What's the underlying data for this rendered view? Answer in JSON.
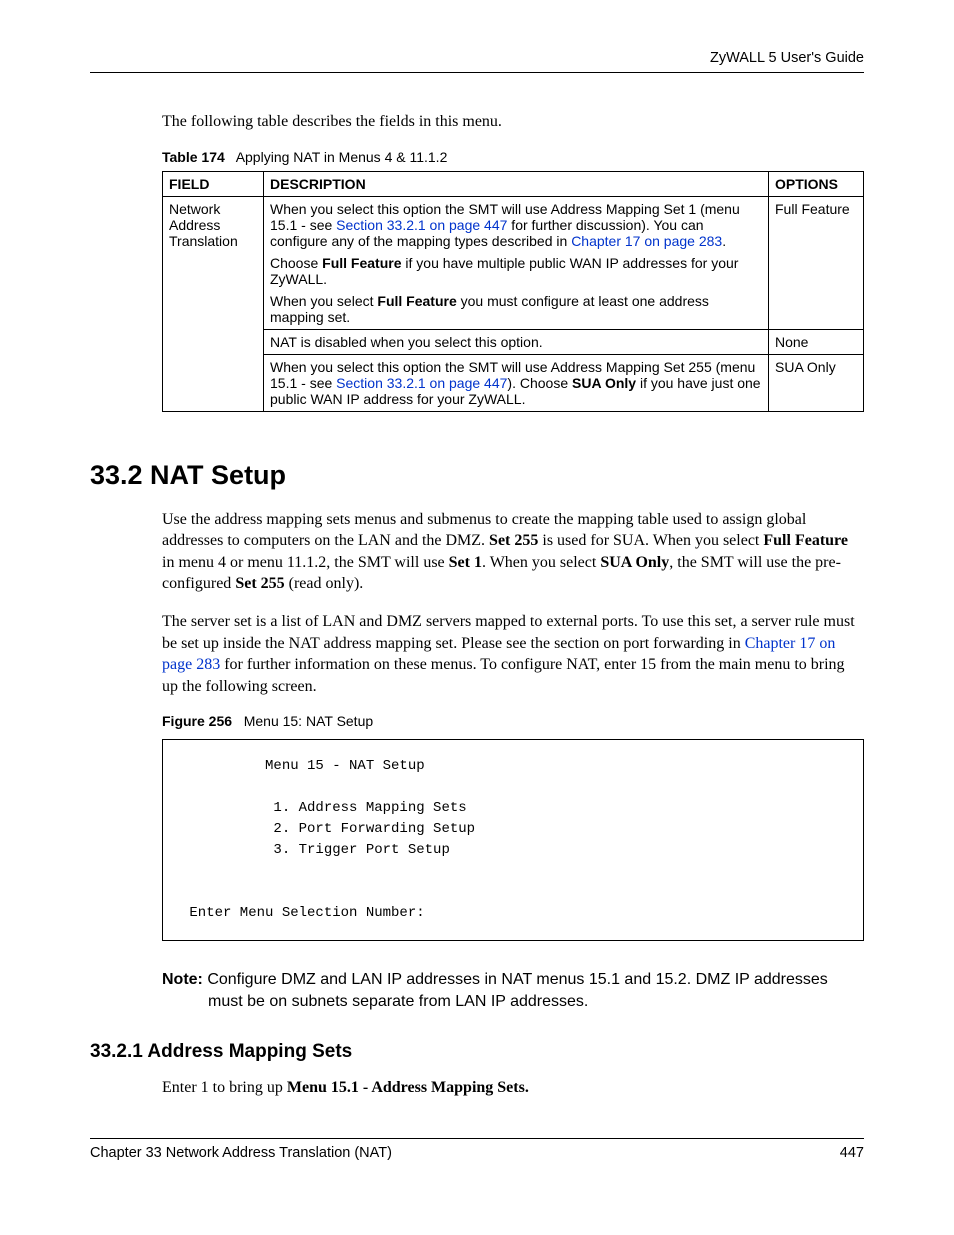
{
  "header": {
    "guide": "ZyWALL 5 User's Guide"
  },
  "intro": "The following table describes the fields in this menu.",
  "table": {
    "caption_num": "Table 174",
    "caption_title": "Applying NAT in Menus 4 & 11.1.2",
    "headers": {
      "field": "FIELD",
      "desc": "DESCRIPTION",
      "options": "OPTIONS"
    },
    "row1": {
      "field": "Network Address Translation",
      "desc_pre_link1": "When you select this option the SMT will use Address Mapping Set 1 (menu 15.1 - see ",
      "link1": "Section 33.2.1 on page 447",
      "desc_mid": " for further discussion). You can configure any of the mapping types described in ",
      "link2": "Chapter 17 on page 283",
      "desc_post": ".",
      "p2a": "Choose ",
      "p2bold": "Full Feature",
      "p2b": " if you have multiple public WAN IP addresses for your ZyWALL.",
      "p3a": "When you select ",
      "p3bold": "Full Feature",
      "p3b": " you must configure at least one address mapping set.",
      "option": "Full Feature"
    },
    "row2": {
      "desc": "NAT is disabled when you select this option.",
      "option": "None"
    },
    "row3": {
      "desc_pre": "When you select this option the SMT will use Address Mapping Set 255 (menu 15.1 - see ",
      "link": "Section 33.2.1 on page 447",
      "desc_mid": "). Choose ",
      "bold": "SUA Only",
      "desc_post": " if you have just one public WAN IP address for your ZyWALL.",
      "option": "SUA Only"
    }
  },
  "section": {
    "heading": "33.2  NAT Setup",
    "p1": {
      "t1": "Use the address mapping sets menus and submenus to create the mapping table used to assign global addresses to computers on the LAN and the DMZ. ",
      "b1": "Set 255",
      "t2": " is used for SUA. When you select ",
      "b2": "Full Feature",
      "t3": " in menu 4 or menu 11.1.2, the SMT will use ",
      "b3": "Set 1",
      "t4": ". When you select ",
      "b4": "SUA Only",
      "t5": ", the SMT will use the pre-configured ",
      "b5": "Set 255",
      "t6": " (read only)."
    },
    "p2": {
      "t1": "The server set is a list of LAN and DMZ servers mapped to external ports. To use this set, a server rule must be set up inside the NAT address mapping set. Please see the section on port forwarding in ",
      "link": "Chapter 17 on page 283",
      "t2": " for further information on these menus. To configure NAT, enter 15 from the main menu to bring up the following screen."
    }
  },
  "figure": {
    "caption_num": "Figure 256",
    "caption_title": "Menu 15: NAT Setup",
    "content": "          Menu 15 - NAT Setup\n\n           1. Address Mapping Sets\n           2. Port Forwarding Setup\n           3. Trigger Port Setup\n\n\n Enter Menu Selection Number:"
  },
  "note": {
    "label": "Note: ",
    "text": "Configure DMZ and LAN IP addresses in NAT menus 15.1 and 15.2. DMZ IP addresses must be on subnets separate from LAN IP addresses."
  },
  "subsection": {
    "heading": "33.2.1  Address Mapping Sets",
    "p1_a": "Enter 1 to bring up ",
    "p1_b": "Menu 15.1 - Address Mapping Sets."
  },
  "footer": {
    "left": "Chapter 33 Network Address Translation (NAT)",
    "right": "447"
  }
}
